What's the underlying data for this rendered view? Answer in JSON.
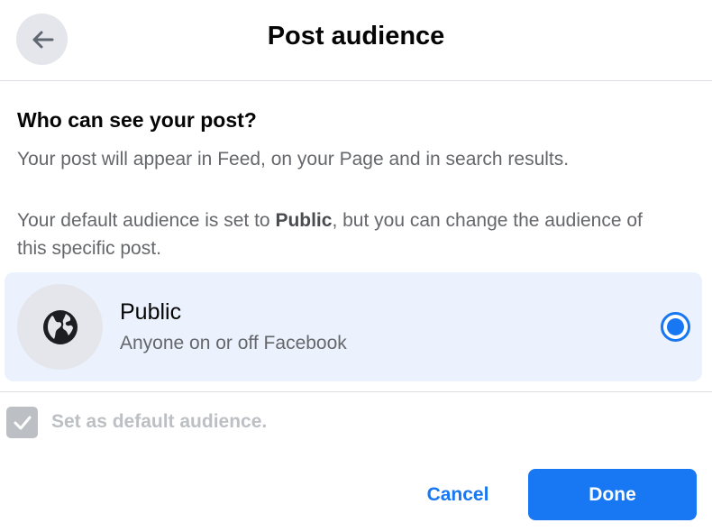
{
  "header": {
    "title": "Post audience",
    "back_icon": "arrow-left-icon"
  },
  "body": {
    "question": "Who can see your post?",
    "description": "Your post will appear in Feed, on your Page and in search results.",
    "default_note_prefix": "Your default audience is set to ",
    "default_note_bold": "Public",
    "default_note_suffix": ", but you can change the audience of this specific post."
  },
  "options": [
    {
      "icon": "globe-icon",
      "title": "Public",
      "subtitle": "Anyone on or off Facebook",
      "selected": true
    }
  ],
  "default_checkbox": {
    "label": "Set as default audience.",
    "checked": true,
    "disabled": true
  },
  "footer": {
    "cancel_label": "Cancel",
    "done_label": "Done"
  },
  "colors": {
    "accent": "#1877f2",
    "selected_bg": "#ebf2fd",
    "icon_bg": "#e4e6eb",
    "secondary_text": "#65676b",
    "disabled": "#bcc0c4"
  }
}
